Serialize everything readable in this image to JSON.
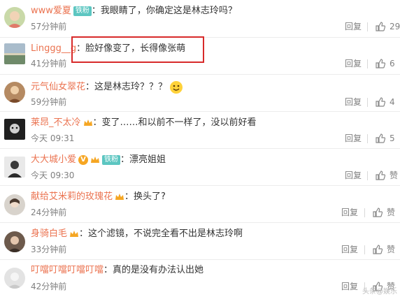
{
  "comments": [
    {
      "name": "www爱夏",
      "badge": "铁粉",
      "text": "我眼睛了，你确定这是林志玲吗？",
      "time": "57分钟前",
      "reply": "回复",
      "likes": "29",
      "avatar_color": "#c9d9a8"
    },
    {
      "name": "Linggg__g",
      "badge": "",
      "text": "脸好像变了，长得像张萌",
      "time": "41分钟前",
      "reply": "回复",
      "likes": "6",
      "avatar_color": "#8fa7b8"
    },
    {
      "name": "元气仙女翠花",
      "badge": "",
      "text": "这是林志玲？？？",
      "time": "59分钟前",
      "reply": "回复",
      "likes": "4",
      "avatar_color": "#b58a62"
    },
    {
      "name": "莱昂_不太冷",
      "badge": "crown",
      "text": "变了……和以前不一样了，没以前好看",
      "time": "今天 09:31",
      "reply": "回复",
      "likes": "5",
      "avatar_color": "#2b2b2b"
    },
    {
      "name": "大大城小爱",
      "badge": "v-fan",
      "text": "漂亮姐姐",
      "time": "今天 09:30",
      "reply": "回复",
      "likes": "",
      "avatar_color": "#3a3a3a"
    },
    {
      "name": "献给艾米莉的玫瑰花",
      "badge": "crown",
      "text": "换头了?",
      "time": "24分钟前",
      "reply": "回复",
      "likes": "",
      "avatar_color": "#d8d3cc"
    },
    {
      "name": "身骑白毛",
      "badge": "crown",
      "text": "这个滤镜，不说完全看不出是林志玲啊",
      "time": "33分钟前",
      "reply": "回复",
      "likes": "",
      "avatar_color": "#6d5a4c"
    },
    {
      "name": "叮噹叮噹叮噹叮噹",
      "badge": "",
      "text": "真的是没有办法认出她",
      "time": "42分钟前",
      "reply": "回复",
      "likes": "",
      "avatar_color": "#e3e3e3"
    }
  ],
  "fan_label": "铁粉",
  "v_label": "V",
  "watermark": "头条@娱乐"
}
